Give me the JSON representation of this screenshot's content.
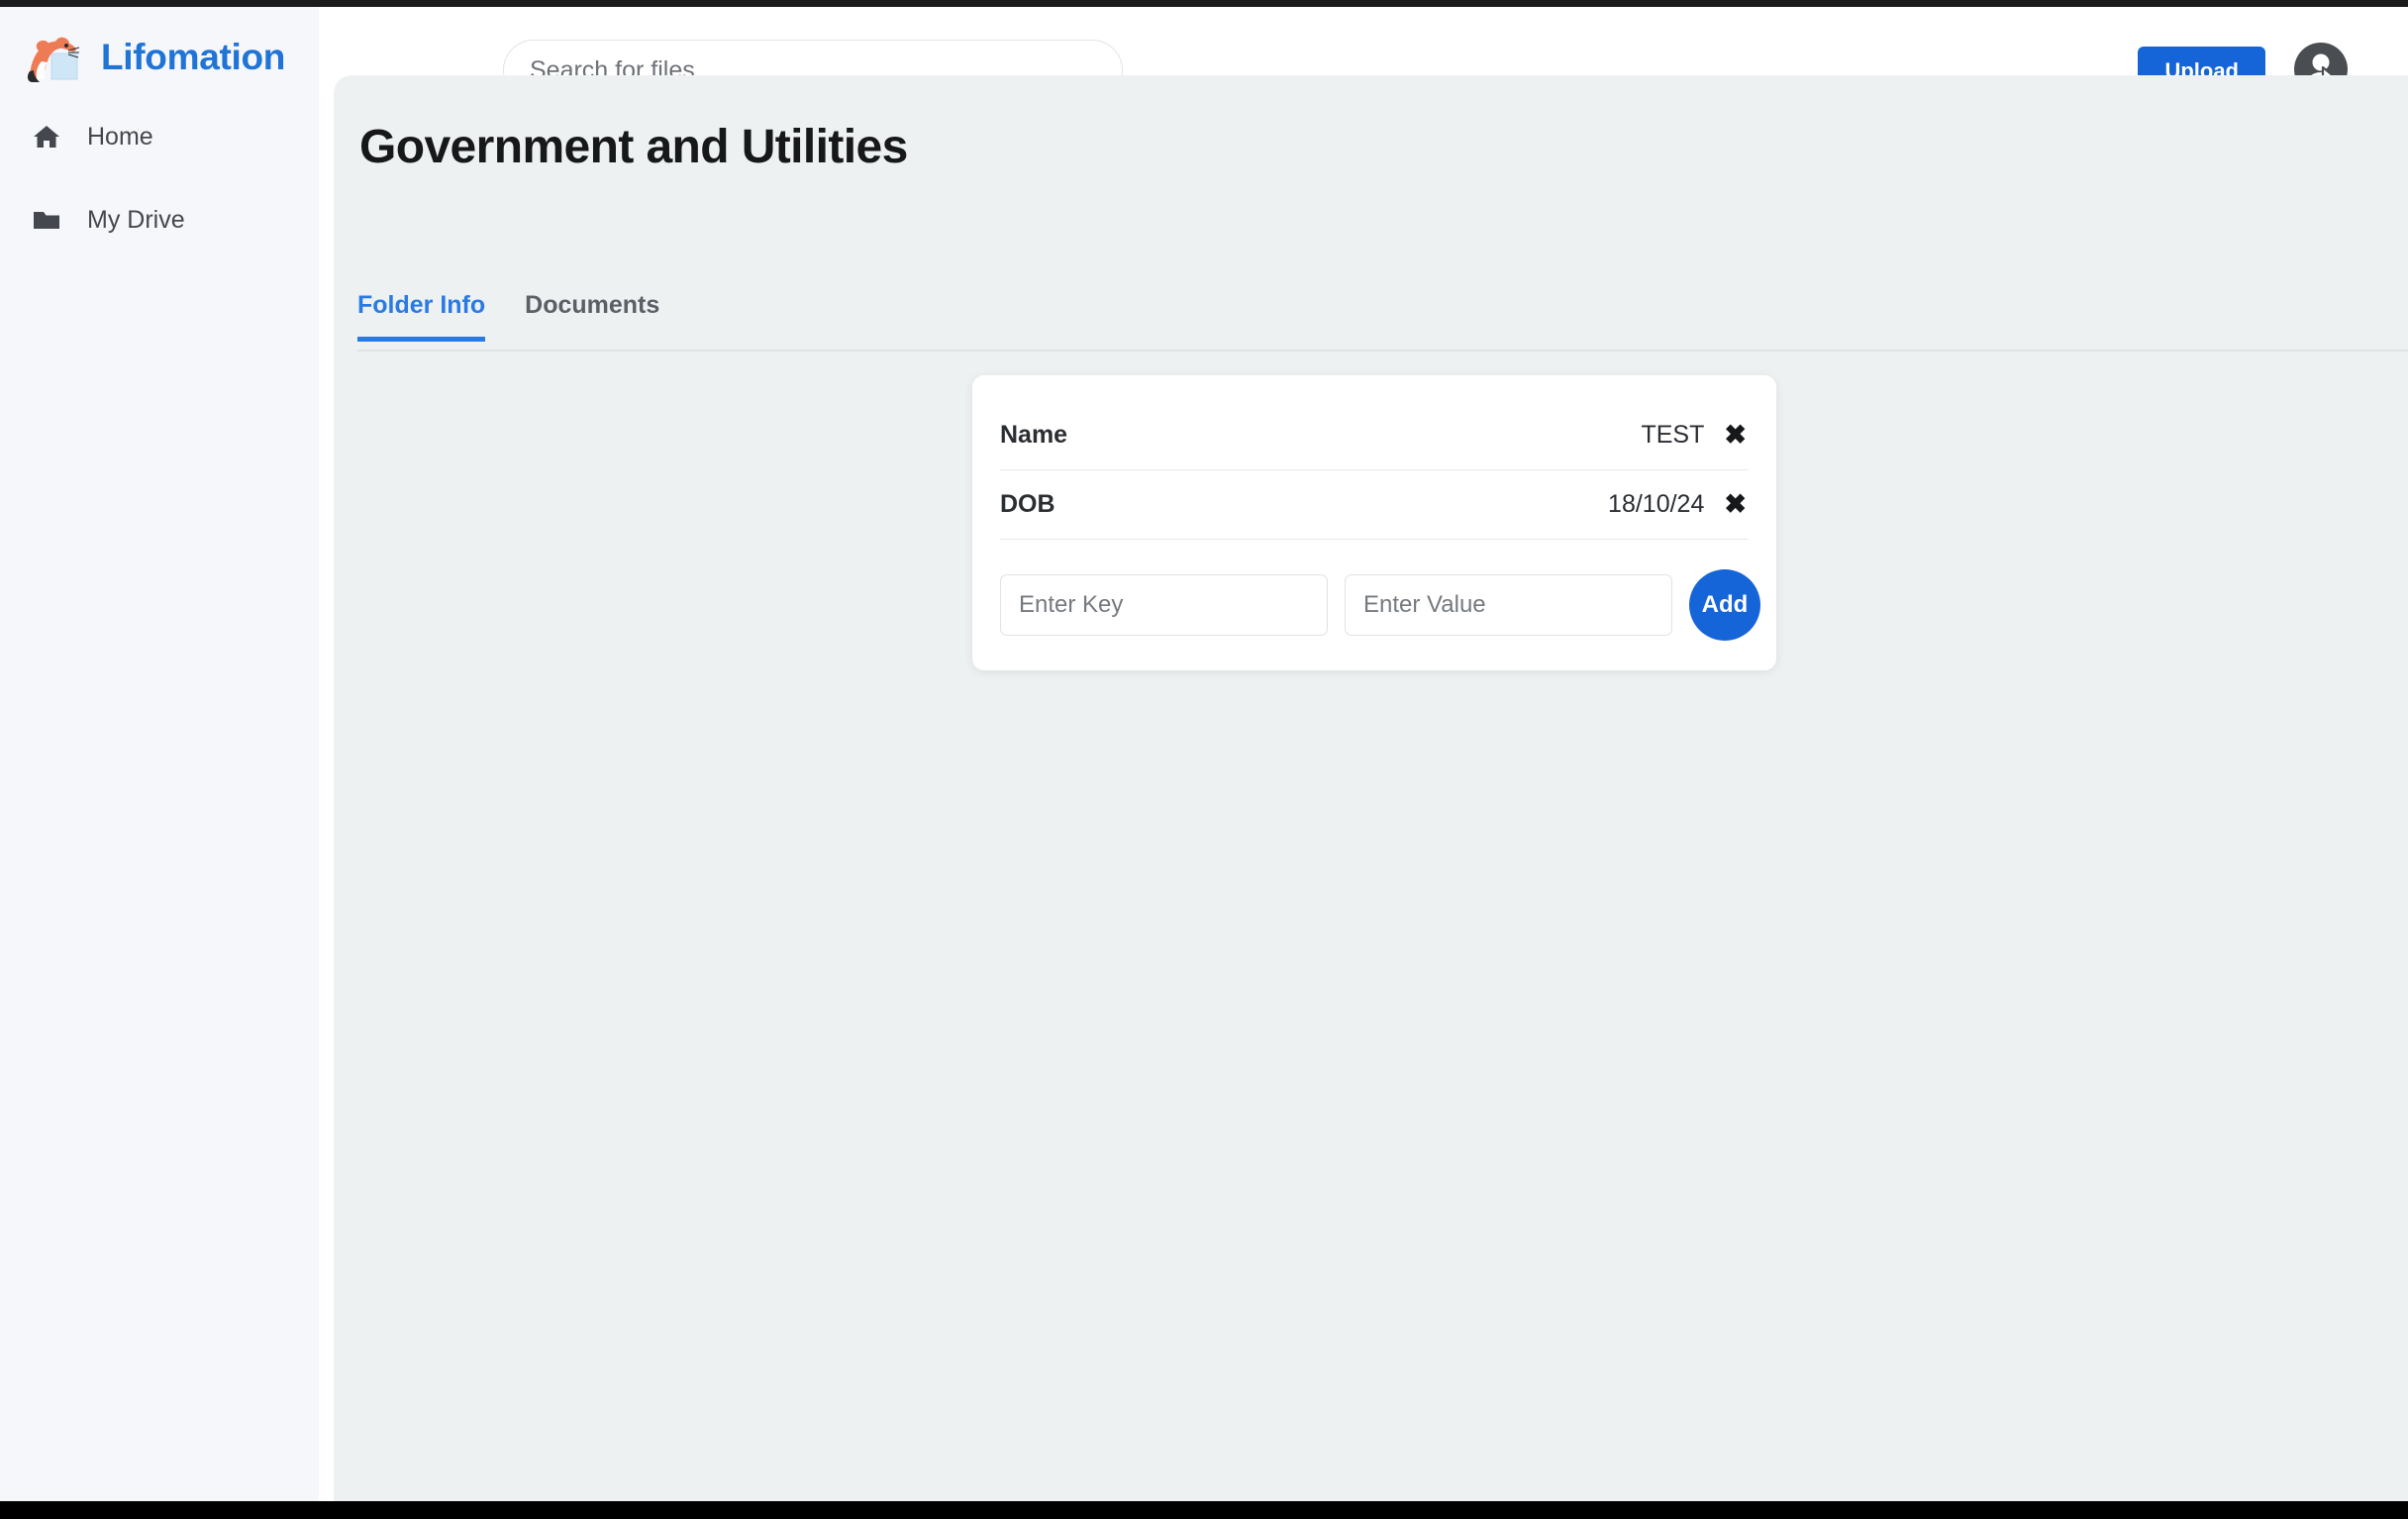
{
  "brand": {
    "name": "Lifomation",
    "logo_icon": "cat-and-box-logo-icon",
    "accent_color": "#1f74d6"
  },
  "header": {
    "search": {
      "placeholder": "Search for files",
      "value": "",
      "icon": "search-input"
    },
    "upload_label": "Upload",
    "upload_color": "#1565d8",
    "avatar_icon": "account-avatar-icon",
    "cursor_icon": "mouse-pointer-icon"
  },
  "sidebar": {
    "items": [
      {
        "label": "Home",
        "icon": "home-icon"
      },
      {
        "label": "My Drive",
        "icon": "folder-icon"
      }
    ]
  },
  "main": {
    "title": "Government and Utilities",
    "tabs": [
      {
        "label": "Folder Info",
        "active": true
      },
      {
        "label": "Documents",
        "active": false
      }
    ],
    "active_tab_color": "#2a7ae2"
  },
  "metadata_card": {
    "rows": [
      {
        "key": "Name",
        "value": "TEST",
        "delete_label": "✖",
        "delete_icon": "delete-row-icon"
      },
      {
        "key": "DOB",
        "value": "18/10/24",
        "delete_label": "✖",
        "delete_icon": "delete-row-icon"
      }
    ],
    "add_form": {
      "key_placeholder": "Enter Key",
      "key_value": "",
      "value_placeholder": "Enter Value",
      "value_value": "",
      "add_label": "Add",
      "add_color": "#1565d8"
    }
  }
}
